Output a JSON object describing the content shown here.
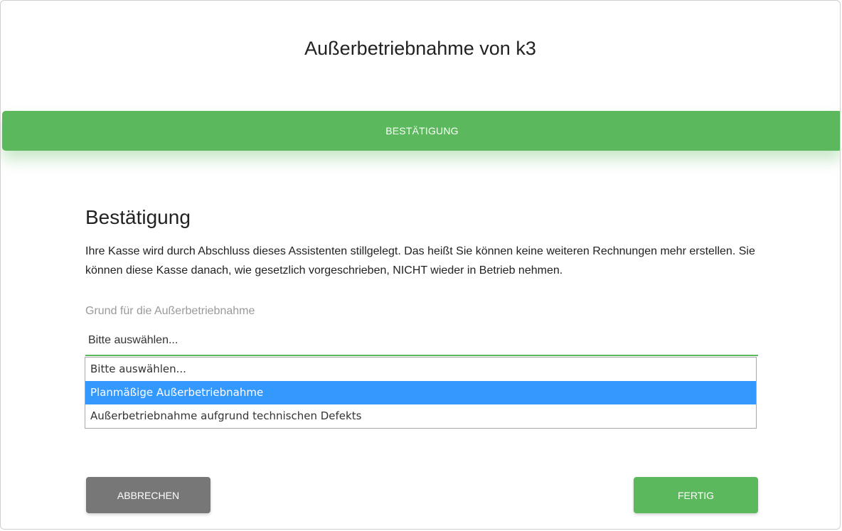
{
  "dialog": {
    "title": "Außerbetriebnahme von k3"
  },
  "stepper": {
    "active_step": "BESTÄTIGUNG"
  },
  "section": {
    "heading": "Bestätigung",
    "description": "Ihre Kasse wird durch Abschluss dieses Assistenten stillgelegt. Das heißt Sie können keine weiteren Rechnungen mehr erstellen. Sie können diese Kasse danach, wie gesetzlich vorgeschrieben, NICHT wieder in Betrieb nehmen."
  },
  "reason_field": {
    "label": "Grund für die Außerbetriebnahme",
    "current_value": "Bitte auswählen...",
    "options": [
      "Bitte auswählen...",
      "Planmäßige Außerbetriebnahme",
      "Außerbetriebnahme aufgrund technischen Defekts"
    ],
    "highlighted_option": "Planmäßige Außerbetriebnahme"
  },
  "buttons": {
    "cancel_label": "ABBRECHEN",
    "done_label": "FERTIG"
  },
  "colors": {
    "accent_green": "#5cb85c",
    "highlight_blue": "#3399ff",
    "cancel_gray": "#777777"
  }
}
